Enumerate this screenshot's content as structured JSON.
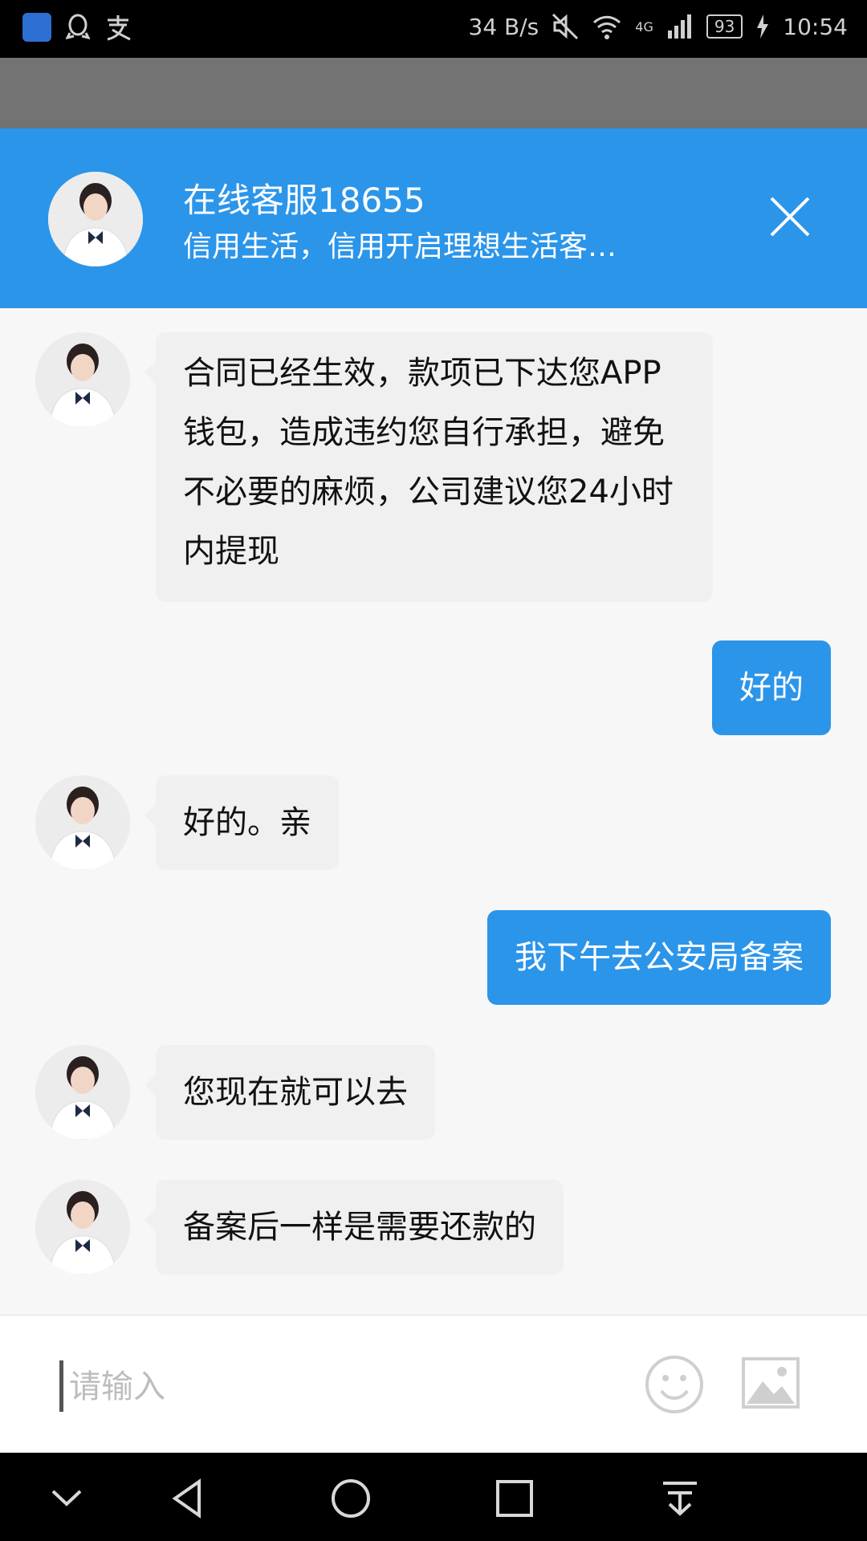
{
  "status_bar": {
    "network_speed": "34 B/s",
    "network_type": "4G",
    "battery": "93",
    "time": "10:54"
  },
  "header": {
    "title": "在线客服18655",
    "subtitle": "信用生活，信用开启理想生活客…"
  },
  "messages": [
    {
      "side": "left",
      "text": "合同已经生效，款项已下达您APP钱包，造成违约您自行承担，避免不必要的麻烦，公司建议您24小时内提现"
    },
    {
      "side": "right",
      "text": "好的"
    },
    {
      "side": "left",
      "text": "好的。亲"
    },
    {
      "side": "right",
      "text": "我下午去公安局备案"
    },
    {
      "side": "left",
      "text": "您现在就可以去"
    },
    {
      "side": "left",
      "text": "备案后一样是需要还款的"
    }
  ],
  "input": {
    "placeholder": "请输入",
    "value": ""
  },
  "colors": {
    "accent": "#2b95ea",
    "left_bubble": "#f0f0f0",
    "background": "#f7f7f7"
  }
}
